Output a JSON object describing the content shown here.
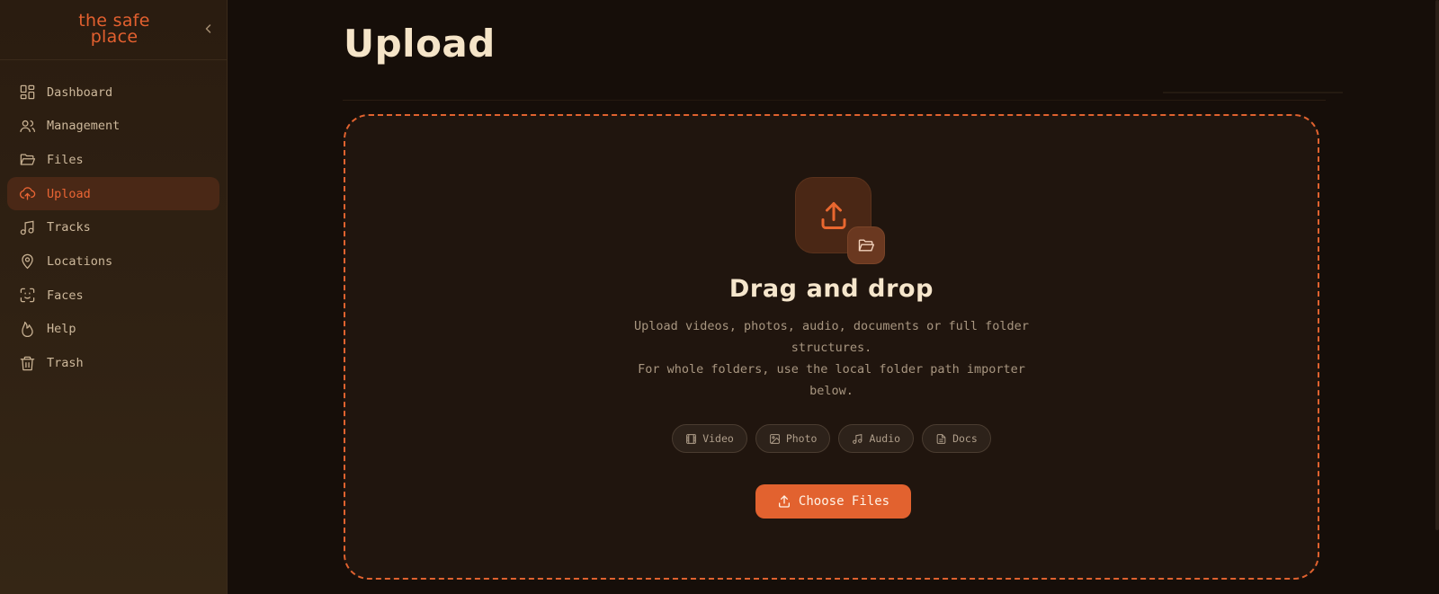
{
  "brand": {
    "logo_line1": "the safe",
    "logo_line2": "place"
  },
  "sidebar": {
    "items": [
      {
        "label": "Dashboard",
        "icon": "dashboard-icon"
      },
      {
        "label": "Management",
        "icon": "users-icon"
      },
      {
        "label": "Files",
        "icon": "folder-open-icon"
      },
      {
        "label": "Upload",
        "icon": "cloud-upload-icon",
        "active": true
      },
      {
        "label": "Tracks",
        "icon": "music-icon"
      },
      {
        "label": "Locations",
        "icon": "map-pin-icon"
      },
      {
        "label": "Faces",
        "icon": "face-scan-icon"
      },
      {
        "label": "Help",
        "icon": "flame-icon"
      },
      {
        "label": "Trash",
        "icon": "trash-icon"
      }
    ]
  },
  "main": {
    "title": "Upload",
    "dropzone": {
      "title": "Drag and drop",
      "desc_line1": "Upload videos, photos, audio, documents or full folder structures.",
      "desc_line2": "For whole folders, use the local folder path importer below.",
      "chips": [
        {
          "label": "Video",
          "icon": "film-icon"
        },
        {
          "label": "Photo",
          "icon": "image-icon"
        },
        {
          "label": "Audio",
          "icon": "music-icon"
        },
        {
          "label": "Docs",
          "icon": "document-icon"
        }
      ],
      "button_label": "Choose Files"
    }
  },
  "colors": {
    "accent": "#e2622f",
    "background": "#160e09",
    "sidebar": "#2f2113",
    "title": "#f5e4c8"
  }
}
